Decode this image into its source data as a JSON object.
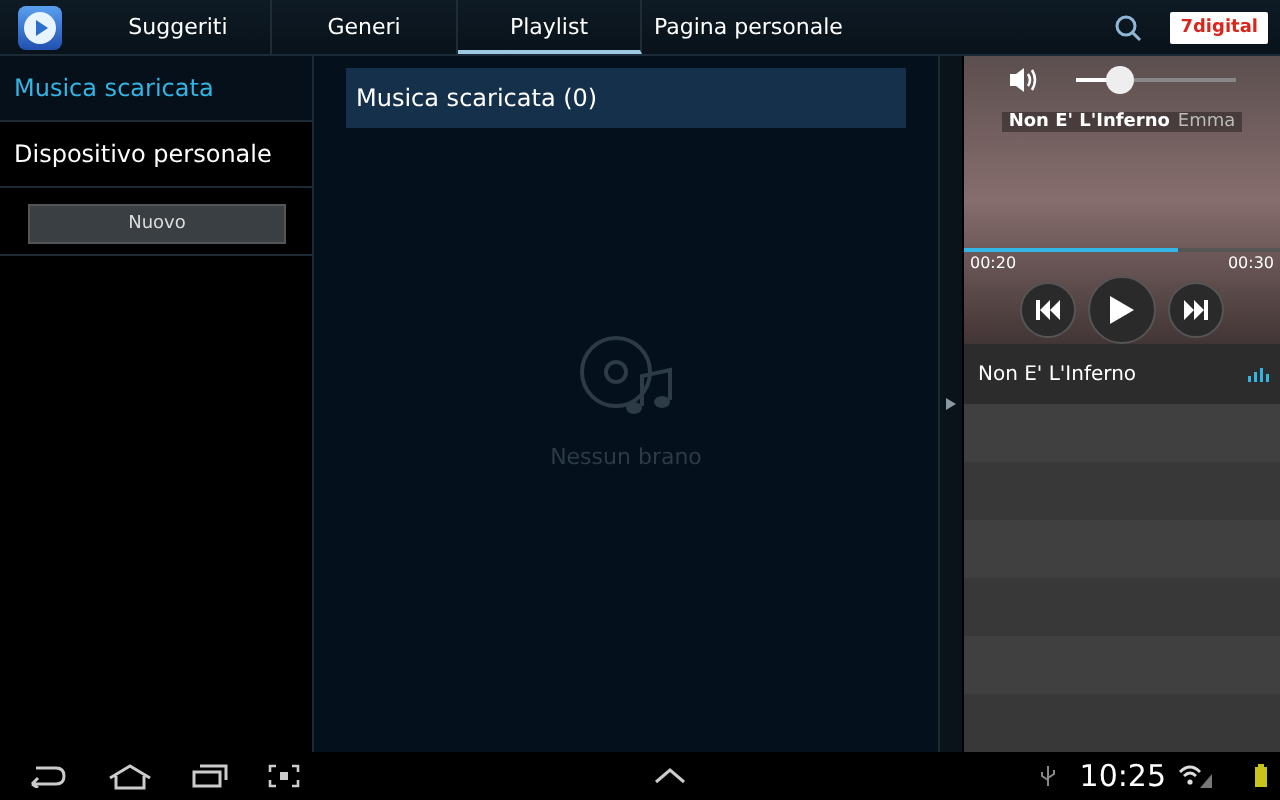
{
  "tabs": [
    {
      "label": "Suggeriti",
      "selected": false
    },
    {
      "label": "Generi",
      "selected": false
    },
    {
      "label": "Playlist",
      "selected": true
    },
    {
      "label": "Pagina personale",
      "selected": false
    }
  ],
  "store_logo": "7digital",
  "sidebar": {
    "items": [
      {
        "label": "Musica scaricata",
        "selected": true
      },
      {
        "label": "Dispositivo personale",
        "selected": false
      }
    ],
    "new_button": "Nuovo"
  },
  "playlist": {
    "header": "Musica scaricata (0)",
    "empty_text": "Nessun brano"
  },
  "player": {
    "volume": {
      "level": 0.28
    },
    "title": "Non E' L'Inferno",
    "artist": "Emma",
    "progress": {
      "level": 0.68
    },
    "elapsed": "00:20",
    "duration": "00:30"
  },
  "queue": [
    {
      "title": "Non E' L'Inferno",
      "playing": true
    }
  ],
  "status_bar": {
    "time": "10:25"
  }
}
